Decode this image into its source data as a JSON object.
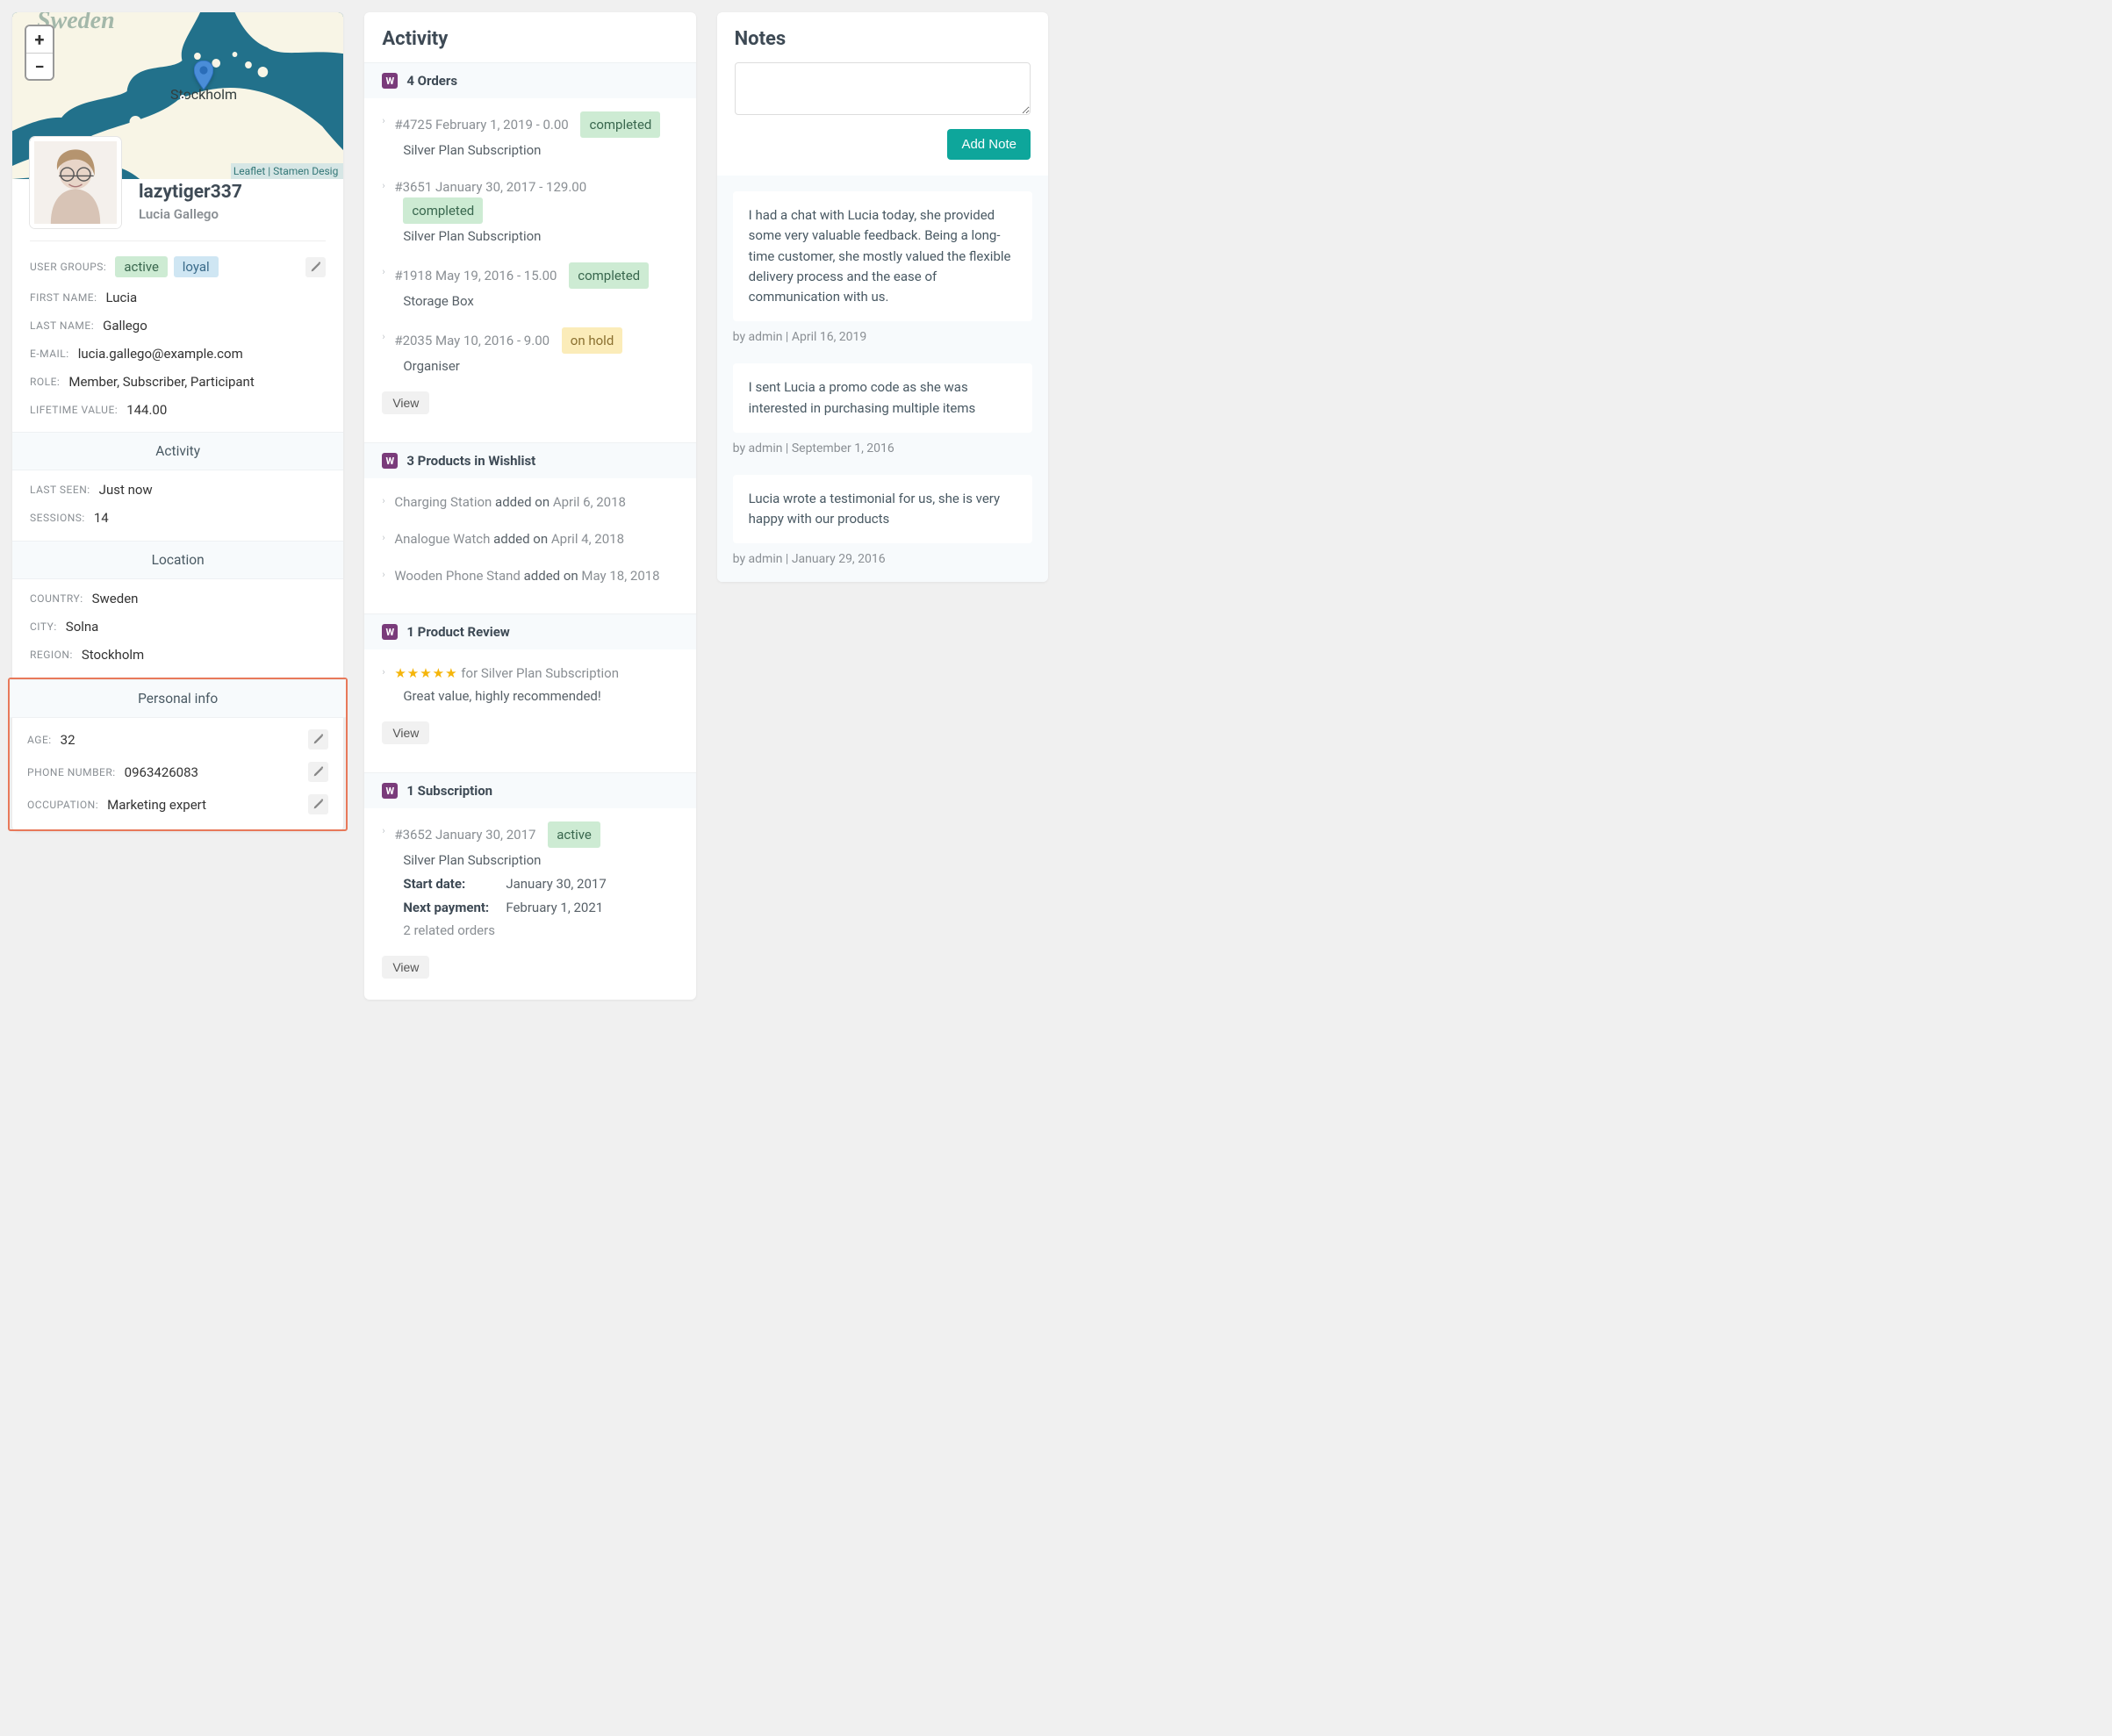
{
  "map": {
    "country_label": "Sweden",
    "city_label": "Stockholm",
    "attribution": "Leaflet | Stamen Desig"
  },
  "profile": {
    "username": "lazytiger337",
    "fullname": "Lucia Gallego",
    "groups_label": "USER GROUPS:",
    "tag_active": "active",
    "tag_loyal": "loyal",
    "first_name_label": "FIRST NAME:",
    "first_name": "Lucia",
    "last_name_label": "LAST NAME:",
    "last_name": "Gallego",
    "email_label": "E-MAIL:",
    "email": "lucia.gallego@example.com",
    "role_label": "ROLE:",
    "role": "Member, Subscriber, Participant",
    "lifetime_label": "LIFETIME VALUE:",
    "lifetime": "144.00"
  },
  "sections": {
    "activity": "Activity",
    "location": "Location",
    "personal": "Personal info"
  },
  "activity_fields": {
    "last_seen_label": "LAST SEEN:",
    "last_seen": "Just now",
    "sessions_label": "SESSIONS:",
    "sessions": "14"
  },
  "location_fields": {
    "country_label": "COUNTRY:",
    "country": "Sweden",
    "city_label": "CITY:",
    "city": "Solna",
    "region_label": "REGION:",
    "region": "Stockholm"
  },
  "personal_fields": {
    "age_label": "AGE:",
    "age": "32",
    "phone_label": "PHONE NUMBER:",
    "phone": "0963426083",
    "occupation_label": "OCCUPATION:",
    "occupation": "Marketing expert"
  },
  "activity_panel": {
    "title": "Activity",
    "orders_header": "4 Orders",
    "orders": [
      {
        "head": "#4725 February 1, 2019 - 0.00",
        "status": "completed",
        "sub": "Silver Plan Subscription"
      },
      {
        "head": "#3651 January 30, 2017 - 129.00",
        "status": "completed",
        "sub": "Silver Plan Subscription"
      },
      {
        "head": "#1918 May 19, 2016 - 15.00",
        "status": "completed",
        "sub": "Storage Box"
      },
      {
        "head": "#2035 May 10, 2016 - 9.00",
        "status": "on hold",
        "sub": "Organiser"
      }
    ],
    "view": "View",
    "wishlist_header": "3 Products in Wishlist",
    "wishlist": [
      {
        "name": "Charging Station",
        "mid": " added on ",
        "date": "April 6, 2018"
      },
      {
        "name": "Analogue Watch",
        "mid": " added on ",
        "date": "April 4, 2018"
      },
      {
        "name": "Wooden Phone Stand",
        "mid": " added on ",
        "date": "May 18, 2018"
      }
    ],
    "review_header": "1 Product Review",
    "review_for": " for Silver Plan Subscription",
    "review_text": "Great value, highly recommended!",
    "subscription_header": "1 Subscription",
    "sub_head": "#3652 January 30, 2017",
    "sub_status": "active",
    "sub_name": "Silver Plan Subscription",
    "sub_start_label": "Start date:",
    "sub_start": "January 30, 2017",
    "sub_next_label": "Next payment:",
    "sub_next": "February 1, 2021",
    "sub_related": "2 related orders"
  },
  "notes_panel": {
    "title": "Notes",
    "add_button": "Add Note",
    "notes": [
      {
        "text": "I had a chat with Lucia today, she provided some very valuable feedback. Being a long-time customer, she mostly valued the flexible delivery process and the ease of communication with us.",
        "meta": "by admin | April 16, 2019"
      },
      {
        "text": "I sent Lucia a promo code as she was interested in purchasing multiple items",
        "meta": "by admin | September 1, 2016"
      },
      {
        "text": "Lucia wrote a testimonial for us, she is very happy with our products",
        "meta": "by admin | January 29, 2016"
      }
    ]
  }
}
